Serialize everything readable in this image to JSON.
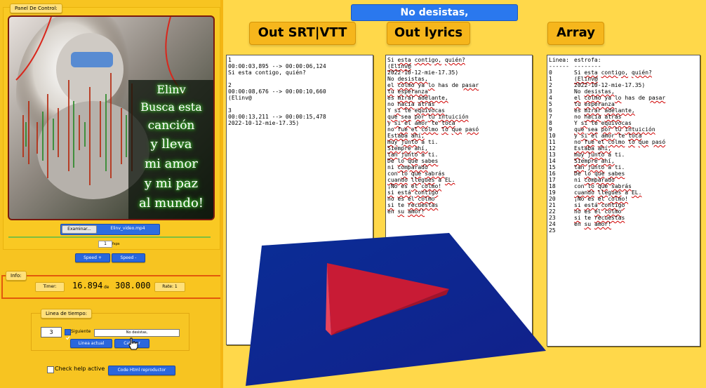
{
  "panel": {
    "title": "Panel De Control:",
    "cover_text": [
      "Elinv",
      "Busca esta",
      "canción",
      "y lleva",
      "mi amor",
      "y mi paz",
      "al mundo!"
    ],
    "file_button_label": "Examinar...",
    "file_name": "Elinv_video.mp4",
    "speed_value": "1",
    "speed_unit": "fxps",
    "speed_up_label": "Speed +",
    "speed_down_label": "Speed -"
  },
  "info": {
    "title": "Info:",
    "timer_label": "Timer:",
    "timer_value": "16.894",
    "de_label": "de",
    "duration_value": "308.000",
    "rate_label": "Rate: 1"
  },
  "timeline": {
    "title": "Linea de tiempo:",
    "line_number": "3",
    "next_label": "Siguiente",
    "next_checked": true,
    "current_lyric": "No desistas,",
    "current_line_button": "Linea actual",
    "calibrate_button": "Calibrar"
  },
  "footer": {
    "help_label": "Check help active",
    "html_button": "Code Html reproductor"
  },
  "header": {
    "current_lyric_title": "No desistas,",
    "srt_heading": "Out SRT|VTT",
    "lyrics_heading": "Out lyrics",
    "array_heading": "Array"
  },
  "srt_output": [
    "1",
    "00:00:03,895 --> 00:00:06,124",
    "Si esta contigo, quién?",
    "",
    "2",
    "00:00:08,676 --> 00:00:10,660",
    "(Elinv@",
    "",
    "3",
    "00:00:13,211 --> 00:00:15,478",
    "2022-10-12-mie-17.35)"
  ],
  "lyrics_output": [
    "Si esta contigo, quién?",
    "(Elinv@",
    "2022-10-12-mie-17.35)",
    "No desistas,",
    "el colmo ya lo has de pasar",
    "tu esperanza",
    "es mirar adelante,",
    "no hacia atrás",
    "Y si te equivocas",
    "que sea por tu intuición",
    "y si el amor te toca",
    "no fue el colmo lo que pasó",
    "Estaba ahí,",
    "muy junto a ti.",
    "Siempre ahí,",
    "tan junto a ti.",
    "De lo que sabes",
    "ni comparado",
    "con lo que sabrás",
    "cuando llegues a EL.",
    "¡No es el colmo!",
    "si está contigo",
    "no es el colmo",
    "si te recuestas",
    "en su amor!"
  ],
  "array_output": {
    "header": [
      "Linea:",
      "estrofa:"
    ],
    "separator": [
      "------",
      "--------"
    ],
    "rows": [
      [
        "0",
        "Si esta contigo, quién?"
      ],
      [
        "1",
        "(Elinv@"
      ],
      [
        "2",
        "2022-10-12-mie-17.35)"
      ],
      [
        "3",
        "No desistas,"
      ],
      [
        "4",
        "el colmo ya lo has de pasar"
      ],
      [
        "5",
        "tu esperanza"
      ],
      [
        "6",
        "es mirar adelante,"
      ],
      [
        "7",
        "no hacia atrás"
      ],
      [
        "8",
        "Y si te equivocas"
      ],
      [
        "9",
        "que sea por tu intuición"
      ],
      [
        "10",
        "y si el amor te toca"
      ],
      [
        "11",
        "no fue el colmo lo que pasó"
      ],
      [
        "12",
        "Estaba ahí,"
      ],
      [
        "13",
        "muy junto a ti."
      ],
      [
        "14",
        "Siempre ahí,"
      ],
      [
        "15",
        "tan junto a ti."
      ],
      [
        "16",
        "De lo que sabes"
      ],
      [
        "17",
        "ni comparado"
      ],
      [
        "18",
        "con lo que sabrás"
      ],
      [
        "19",
        "cuando llegues a EL."
      ],
      [
        "20",
        "¡No es el colmo!"
      ],
      [
        "21",
        "si está contigo"
      ],
      [
        "22",
        "no es el colmo"
      ],
      [
        "23",
        "si te recuestas"
      ],
      [
        "24",
        "en su amor!"
      ],
      [
        "25",
        ""
      ]
    ]
  },
  "colors": {
    "panel_bg": "#f7c421",
    "page_bg": "#ffd84a",
    "accent_blue": "#2a67dd",
    "heading_orange": "#f6b61c",
    "info_border": "#e2590c",
    "play_square": "#0a2c91",
    "play_triangle": "#d81e3a"
  },
  "icons": {
    "play": "play-icon",
    "cursor": "hand-cursor-icon"
  }
}
